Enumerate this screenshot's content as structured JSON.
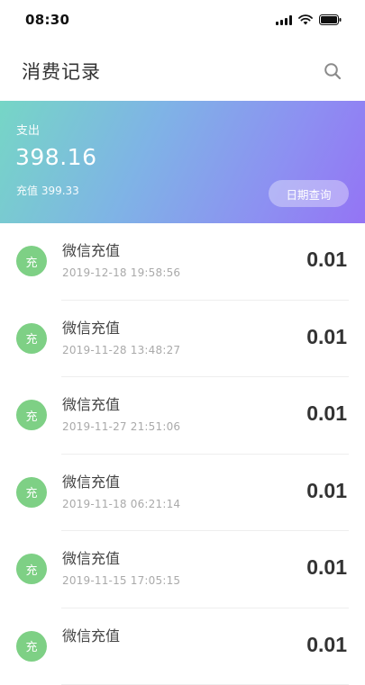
{
  "status_bar": {
    "time": "08:30"
  },
  "header": {
    "title": "消费记录",
    "search_icon": "search-icon"
  },
  "summary": {
    "expense_label": "支出",
    "expense_value": "398.16",
    "recharge_text": "充值 399.33",
    "date_query_label": "日期查询"
  },
  "records": [
    {
      "icon_text": "充",
      "title": "微信充值",
      "time": "2019-12-18 19:58:56",
      "amount": "0.01"
    },
    {
      "icon_text": "充",
      "title": "微信充值",
      "time": "2019-11-28 13:48:27",
      "amount": "0.01"
    },
    {
      "icon_text": "充",
      "title": "微信充值",
      "time": "2019-11-27 21:51:06",
      "amount": "0.01"
    },
    {
      "icon_text": "充",
      "title": "微信充值",
      "time": "2019-11-18 06:21:14",
      "amount": "0.01"
    },
    {
      "icon_text": "充",
      "title": "微信充值",
      "time": "2019-11-15 17:05:15",
      "amount": "0.01"
    },
    {
      "icon_text": "充",
      "title": "微信充值",
      "time": "",
      "amount": "0.01"
    }
  ],
  "colors": {
    "card_gradient_start": "#76d6c6",
    "card_gradient_end": "#9474f4",
    "record_icon": "#7ed085"
  }
}
